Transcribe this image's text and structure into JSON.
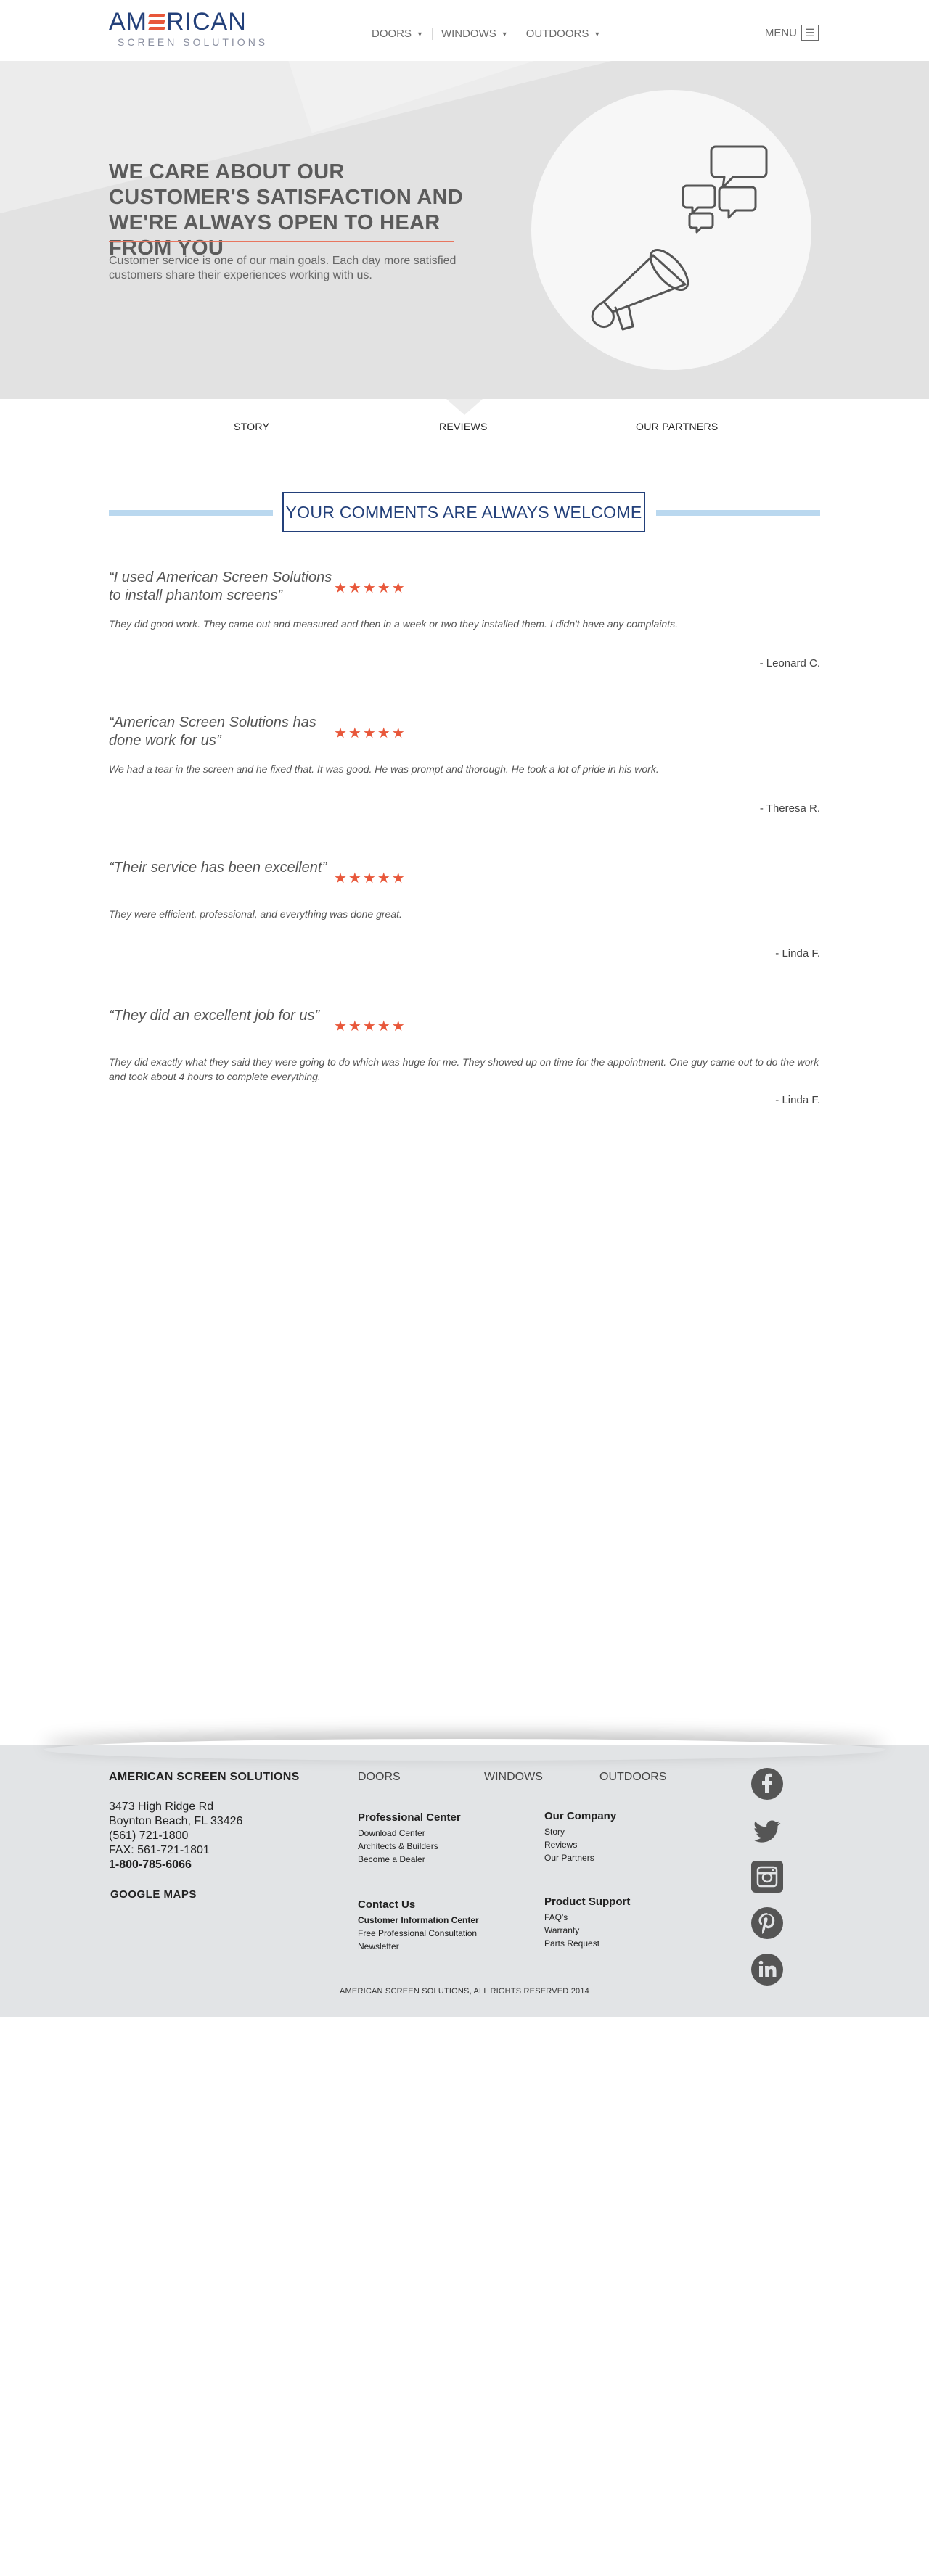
{
  "header": {
    "logo_part1": "AM",
    "logo_part2": "RICAN",
    "logo_sub": "SCREEN SOLUTIONS",
    "nav": [
      {
        "label": "DOORS"
      },
      {
        "label": "WINDOWS"
      },
      {
        "label": "OUTDOORS"
      }
    ],
    "menu_label": "MENU",
    "menu_icon": "hamburger-icon"
  },
  "hero": {
    "title": "WE CARE ABOUT OUR CUSTOMER'S SATISFACTION AND WE'RE ALWAYS OPEN TO HEAR FROM YOU",
    "text": "Customer service is one of our main goals. Each day more satisfied customers share their experiences working with us.",
    "illustration": "megaphone-speech-bubbles-icon"
  },
  "tabs": {
    "story": "STORY",
    "reviews": "REVIEWS",
    "partners": "OUR PARTNERS",
    "active": "REVIEWS"
  },
  "section_title": "YOUR COMMENTS ARE ALWAYS WELCOME",
  "reviews": [
    {
      "quote": "“I used American Screen Solutions to install phantom screens”",
      "stars": "★★★★★",
      "rating": 5,
      "body": "They did good work. They came out and measured and then in a week or two they installed them. I didn't have any complaints.",
      "author": "- Leonard C."
    },
    {
      "quote": "“American Screen Solutions has done work for us”",
      "stars": "★★★★★",
      "rating": 5,
      "body": "We had a tear in the screen and he fixed that. It was good. He was prompt and thorough. He took a lot of pride in his work.",
      "author": "- Theresa R."
    },
    {
      "quote": "“Their service has been excellent”",
      "stars": "★★★★★",
      "rating": 5,
      "body": "They were efficient, professional, and everything was done great.",
      "author": "- Linda F."
    },
    {
      "quote": "“They did an excellent job for us”",
      "stars": "★★★★★",
      "rating": 5,
      "body": "They did exactly what they said they were going to do which was huge for me. They showed up on time for the appointment. One guy came out to do the work and took about 4 hours to complete everything.",
      "author": "- Linda F."
    }
  ],
  "footer": {
    "company": "AMERICAN SCREEN SOLUTIONS",
    "address1": "3473 High Ridge Rd",
    "address2": "Boynton Beach, FL 33426",
    "phone": "(561) 721-1800",
    "fax": "FAX: 561-721-1801",
    "tollfree": "1-800-785-6066",
    "maps": "GOOGLE MAPS",
    "categories": [
      "DOORS",
      "WINDOWS",
      "OUTDOORS"
    ],
    "professional": {
      "title": "Professional Center",
      "links": [
        "Download Center",
        "Architects & Builders",
        "Become a Dealer"
      ]
    },
    "company_group": {
      "title": "Our Company",
      "links": [
        "Story",
        "Reviews",
        "Our Partners"
      ]
    },
    "contact": {
      "title": "Contact Us",
      "links": [
        "Customer Information Center",
        "Free Professional Consultation",
        "Newsletter"
      ]
    },
    "support": {
      "title": "Product Support",
      "links": [
        "FAQ's",
        "Warranty",
        "Parts Request"
      ]
    },
    "social": [
      "facebook-icon",
      "twitter-icon",
      "instagram-icon",
      "pinterest-icon",
      "linkedin-icon"
    ],
    "copyright": "AMERICAN SCREEN SOLUTIONS, ALL RIGHTS RESERVED 2014"
  },
  "colors": {
    "brand_blue": "#23407a",
    "accent_orange": "#e8573a",
    "rule_blue": "#bad8ef",
    "footer_bg": "#e2e4e6"
  }
}
